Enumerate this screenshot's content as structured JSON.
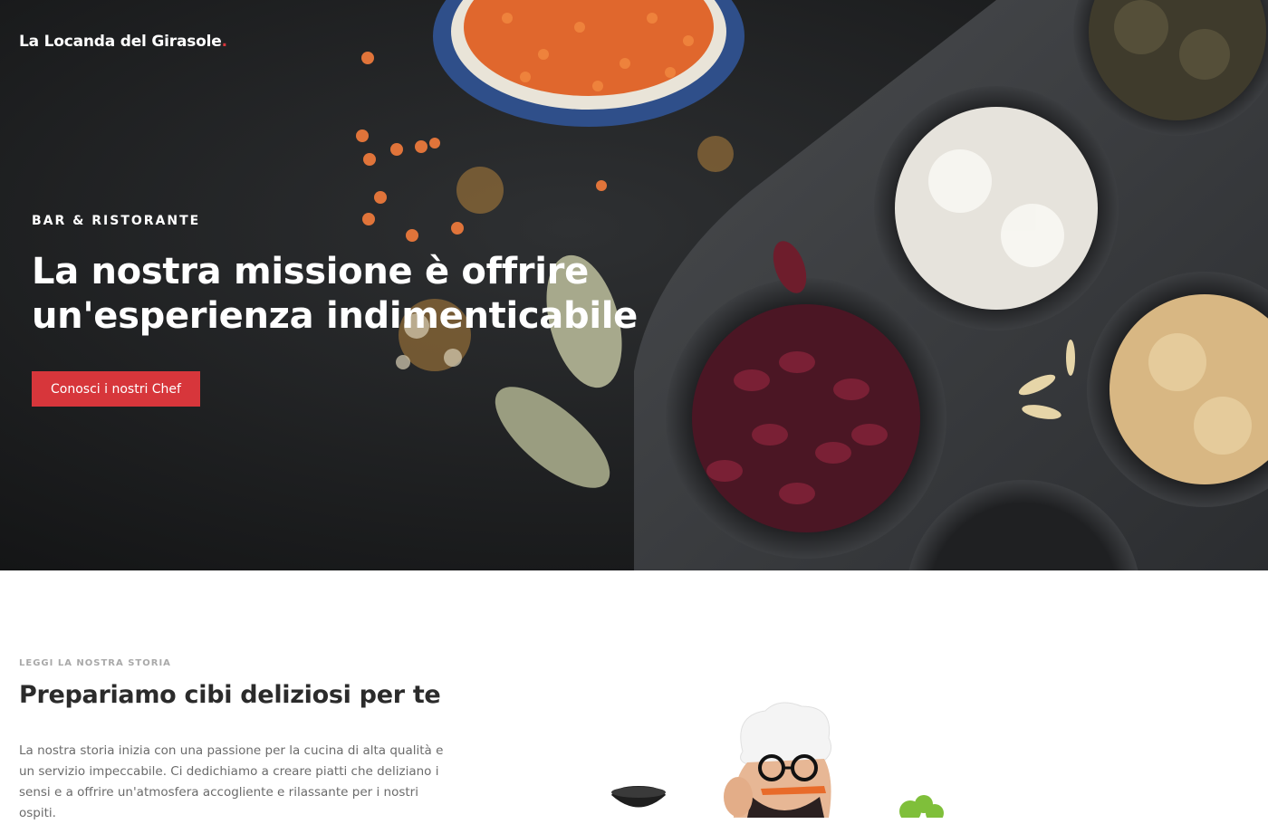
{
  "header": {
    "brand": "La Locanda del Girasole",
    "brand_dot": "."
  },
  "hero": {
    "kicker": "BAR & RISTORANTE",
    "title_line1": "La nostra missione è offrire",
    "title_line2": "un'esperienza indimenticabile",
    "cta_label": "Conosci i nostri Chef"
  },
  "story": {
    "kicker": "LEGGI LA NOSTRA STORIA",
    "title": "Prepariamo cibi deliziosi per te",
    "text": "La nostra storia inizia con una passione per la cucina di alta qualità e un servizio impeccabile. Ci dedichiamo a creare piatti che deliziano i sensi e a offrire un'atmosfera accogliente e rilassante per i nostri ospiti."
  },
  "colors": {
    "accent": "#d7363b",
    "hero_bg": "#1b1c1e"
  }
}
